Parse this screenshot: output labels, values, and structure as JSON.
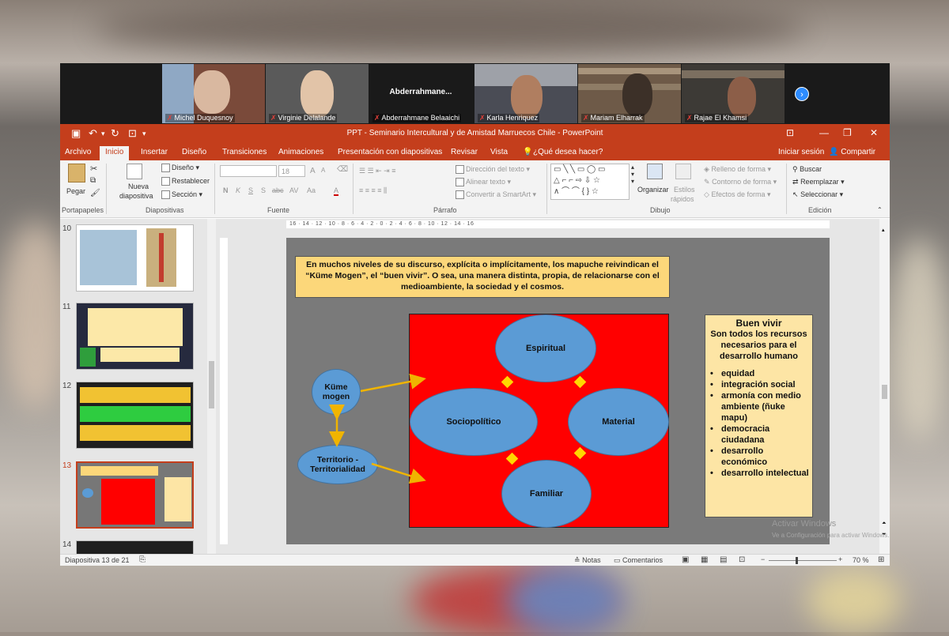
{
  "participants": [
    {
      "name": "Michel Duquesnoy",
      "bg": "#7a4a3a"
    },
    {
      "name": "Virginie Delalande",
      "bg": "#5a5a5a"
    },
    {
      "name": "Abderrahmane Belaaichi",
      "bg": "#1a1a1a",
      "title": "Abderrahmane..."
    },
    {
      "name": "Karla Henriquez",
      "bg": "#4a4c55"
    },
    {
      "name": "Mariam Elharrak",
      "bg": "#6e5a48"
    },
    {
      "name": "Rajae El Khamsi",
      "bg": "#3d3a36"
    }
  ],
  "window_title": "PPT - Seminario Intercultural y de Amistad Marruecos Chile - PowerPoint",
  "menu": [
    "Archivo",
    "Inicio",
    "Insertar",
    "Diseño",
    "Transiciones",
    "Animaciones",
    "Presentación con diapositivas",
    "Revisar",
    "Vista",
    "¿Qué desea hacer?"
  ],
  "signin": "Iniciar sesión",
  "share": "Compartir",
  "ribbon": {
    "paste": "Pegar",
    "clipboard": "Portapapeles",
    "new_slide": "Nueva",
    "new_slide2": "diapositiva",
    "layout": "Diseño",
    "reset": "Restablecer",
    "section": "Sección",
    "slides": "Diapositivas",
    "font_size": "18",
    "font": "Fuente",
    "paragraph": "Párrafo",
    "text_dir": "Dirección del texto",
    "align_text": "Alinear texto",
    "smartart": "Convertir a SmartArt",
    "arrange": "Organizar",
    "quick_styles": "Estilos",
    "quick_styles2": "rápidos",
    "drawing": "Dibujo",
    "shape_fill": "Relleno de forma",
    "shape_outline": "Contorno de forma",
    "shape_effects": "Efectos de forma",
    "find": "Buscar",
    "replace": "Reemplazar",
    "select": "Seleccionar",
    "editing": "Edición",
    "bold": "N",
    "italic": "K",
    "underline": "S",
    "strike": "S",
    "spacing": "AV",
    "case": "Aa",
    "color": "A"
  },
  "ruler_h": "16 · 14 · 12 · 10 · 8 · 6 · 4 · 2 · 0 · 2 · 4 · 6 · 8 · 10 · 12 · 14 · 16",
  "thumbnails": [
    {
      "num": "10"
    },
    {
      "num": "11"
    },
    {
      "num": "12"
    },
    {
      "num": "13"
    },
    {
      "num": "14"
    }
  ],
  "slide": {
    "quote": "En muchos niveles de su discurso, explícita o implícitamente, los mapuche reivindican el “Küme Mogen”, el “buen vivir”. O sea, una manera distinta, propia, de relacionarse con el medioambiente, la sociedad y el cosmos.",
    "kume": "Küme mogen",
    "territorio": "Territorio - Territorialidad",
    "espiritual": "Espiritual",
    "sociopolitico": "Sociopolítico",
    "material": "Material",
    "familiar": "Familiar",
    "side_title": "Buen vivir",
    "side_sub": "Son todos los recursos necesarios para el desarrollo humano",
    "side_items": [
      "equidad",
      "integración social",
      "armonía con medio ambiente (ñuke mapu)",
      "democracia ciudadana",
      "desarrollo económico",
      "desarrollo intelectual"
    ]
  },
  "watermark": "Activar Windows",
  "watermark_sub": "Ve a Configuración para activar Windows.",
  "status": {
    "slide": "Diapositiva 13 de 21",
    "notes": "Notas",
    "comments": "Comentarios",
    "zoom": "70 %"
  }
}
